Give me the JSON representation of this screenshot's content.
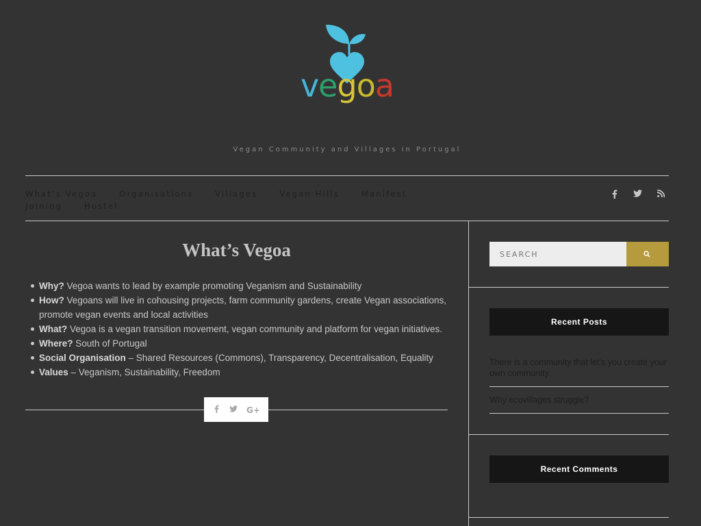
{
  "site": {
    "logo_letters": [
      "v",
      "e",
      "g",
      "o",
      "a"
    ],
    "logo_colors": [
      "#45b5d8",
      "#2e9e6a",
      "#d6c43a",
      "#c8b930",
      "#c7392c"
    ],
    "heart_color": "#4fc1e0",
    "tagline": "Vegan Community and Villages in Portugal"
  },
  "nav": {
    "items": [
      "What’s Vegoa",
      "Organisations",
      "Villages",
      "Vegan Hills",
      "Manifest",
      "Joining",
      "Hostel"
    ]
  },
  "social": {
    "icons": [
      "facebook-icon",
      "twitter-icon",
      "rss-icon"
    ],
    "glyphs": [
      "f",
      "t",
      "rss"
    ]
  },
  "post": {
    "title": "What’s Vegoa",
    "items": [
      {
        "label": "Why?",
        "text": " Vegoa wants to lead by example promoting Veganism and Sustainability"
      },
      {
        "label": "How?",
        "text": " Vegoans will live in cohousing projects, farm community gardens, create Vegan associations, promote vegan events and local activities"
      },
      {
        "label": "What?",
        "text": " Vegoa is a vegan transition movement, vegan community and platform for vegan initiatives."
      },
      {
        "label": "Where?",
        "text": " South of Portugal"
      },
      {
        "label": "Social Organisation",
        "text": " – Shared Resources (Commons), Transparency, Decentralisation, Equality"
      },
      {
        "label": "Values",
        "text": " – Veganism, Sustainability, Freedom"
      }
    ],
    "share_glyphs": [
      "f",
      "t",
      "G+"
    ]
  },
  "sidebar": {
    "search_placeholder": "SEARCH",
    "search_button_color": "#b59a3e",
    "recent_posts_title": "Recent Posts",
    "recent_posts": [
      "There is a community that let’s you create your own community.",
      "Why ecovillages struggle?"
    ],
    "recent_comments_title": "Recent Comments"
  }
}
